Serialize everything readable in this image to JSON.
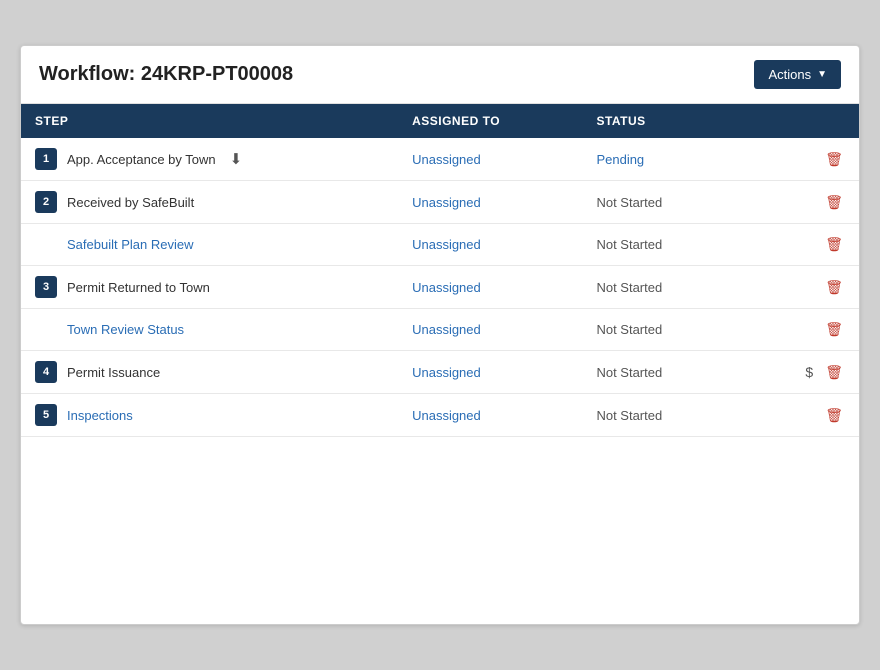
{
  "header": {
    "title": "Workflow: 24KRP-PT00008",
    "actions_label": "Actions",
    "chevron": "▼"
  },
  "table": {
    "columns": {
      "step": "STEP",
      "assigned_to": "ASSIGNED TO",
      "status": "STATUS",
      "actions": ""
    },
    "rows": [
      {
        "badge": "1",
        "step_text": "App. Acceptance by Town",
        "is_link": false,
        "has_download": true,
        "assigned": "Unassigned",
        "status": "Pending",
        "status_is_link": true,
        "has_dollar": false,
        "has_delete": true
      },
      {
        "badge": "2",
        "step_text": "Received by SafeBuilt",
        "is_link": false,
        "has_download": false,
        "assigned": "Unassigned",
        "status": "Not Started",
        "status_is_link": false,
        "has_dollar": false,
        "has_delete": true
      },
      {
        "badge": "",
        "step_text": "Safebuilt Plan Review",
        "is_link": true,
        "has_download": false,
        "assigned": "Unassigned",
        "status": "Not Started",
        "status_is_link": false,
        "has_dollar": false,
        "has_delete": true
      },
      {
        "badge": "3",
        "step_text": "Permit Returned to Town",
        "is_link": false,
        "has_download": false,
        "assigned": "Unassigned",
        "status": "Not Started",
        "status_is_link": false,
        "has_dollar": false,
        "has_delete": true
      },
      {
        "badge": "",
        "step_text": "Town Review Status",
        "is_link": true,
        "has_download": false,
        "assigned": "Unassigned",
        "status": "Not Started",
        "status_is_link": false,
        "has_dollar": false,
        "has_delete": true
      },
      {
        "badge": "4",
        "step_text": "Permit Issuance",
        "is_link": false,
        "has_download": false,
        "assigned": "Unassigned",
        "status": "Not Started",
        "status_is_link": false,
        "has_dollar": true,
        "has_delete": true
      },
      {
        "badge": "5",
        "step_text": "Inspections",
        "is_link": true,
        "has_download": false,
        "assigned": "Unassigned",
        "status": "Not Started",
        "status_is_link": false,
        "has_dollar": false,
        "has_delete": true
      }
    ]
  }
}
